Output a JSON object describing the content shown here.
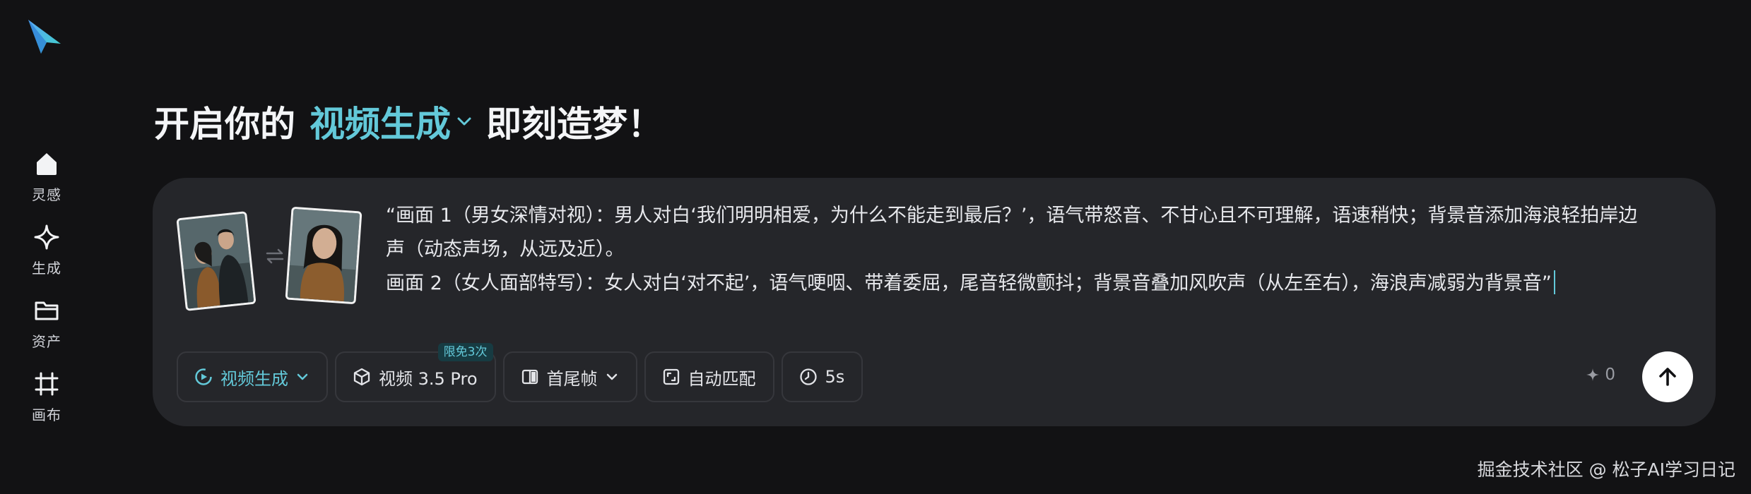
{
  "sidebar": {
    "items": [
      {
        "label": "灵感",
        "icon": "home-icon"
      },
      {
        "label": "生成",
        "icon": "sparkle-icon"
      },
      {
        "label": "资产",
        "icon": "folder-icon"
      },
      {
        "label": "画布",
        "icon": "canvas-icon"
      }
    ]
  },
  "headline": {
    "prefix": "开启你的",
    "mode": "视频生成",
    "suffix": "即刻造梦！"
  },
  "prompt": {
    "lines": [
      "“画面 1（男女深情对视）：男人对白‘我们明明相爱，为什么不能走到最后？’，语气带怒音、不甘心且不可理解，语速稍快；背景音添加海浪轻拍岸边",
      "声（动态声场，从远及近）。",
      "画面 2（女人面部特写）：女人对白‘对不起’，语气哽咽、带着委屈，尾音轻微颤抖；背景音叠加风吹声（从左至右），海浪声减弱为背景音”"
    ]
  },
  "toolbar": {
    "mode": "视频生成",
    "model": "视频 3.5 Pro",
    "model_badge": "限免3次",
    "frames": "首尾帧",
    "ratio": "自动匹配",
    "duration": "5s"
  },
  "credits": "0",
  "watermark": "掘金技术社区 @ 松子AI学习日记",
  "colors": {
    "accent": "#63c9d9",
    "background": "#121214",
    "panel": "#25262a"
  }
}
